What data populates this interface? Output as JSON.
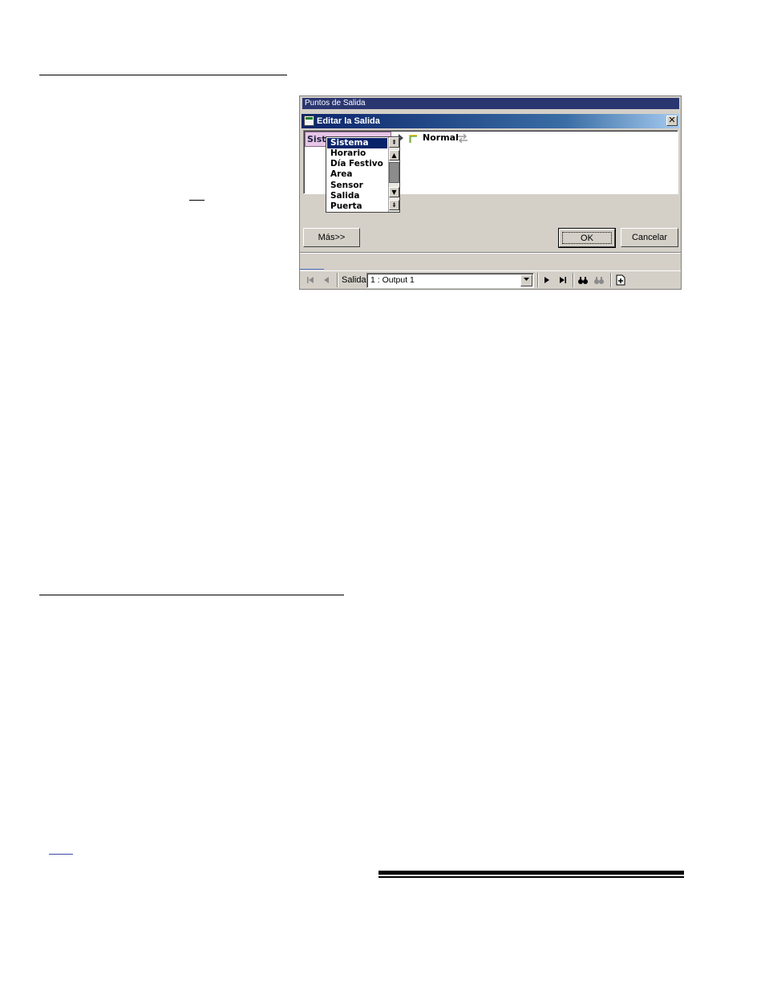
{
  "outer_window": {
    "title": "Puntos de Salida"
  },
  "dialog": {
    "title": "Editar la Salida",
    "close_glyph": "✕"
  },
  "condition": {
    "chip_label": "Siste",
    "state_label": "Normal"
  },
  "dropdown": {
    "items": [
      "Sistema",
      "Horario",
      "Día Festivo",
      "Area",
      "Sensor",
      "Salida",
      "Puerta"
    ],
    "selected_index": 0,
    "scroll_top": "⇞",
    "scroll_up": "▲",
    "scroll_down": "▼",
    "scroll_bottom": "⇟"
  },
  "buttons": {
    "more": "Más>>",
    "ok": "OK",
    "cancel": "Cancelar"
  },
  "toolbar": {
    "salida_label": "Salida:",
    "selected_output": "1 : Output 1",
    "icons": [
      "first-record-icon",
      "prev-record-icon",
      "next-record-icon",
      "last-record-icon",
      "find-icon",
      "find-next-icon",
      "new-record-icon"
    ]
  },
  "colors": {
    "title_bar": "#0b246a",
    "outer_title_bar": "#2a3670",
    "selection": "#0a246a",
    "chip_bg": "#e7c6e7",
    "window_bg": "#d4d0c8"
  }
}
